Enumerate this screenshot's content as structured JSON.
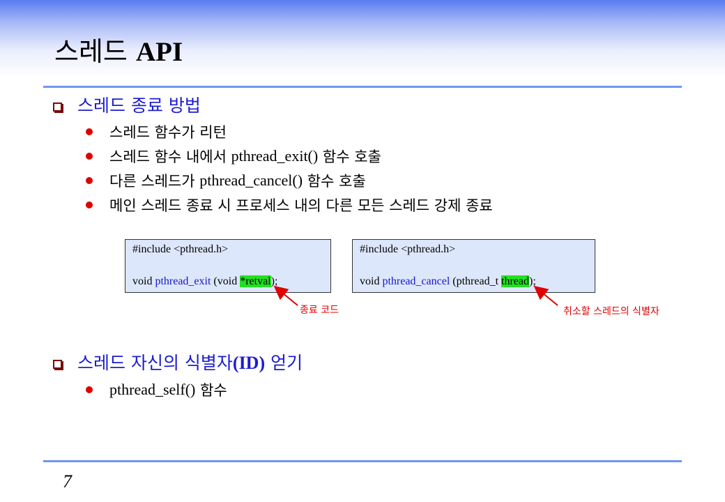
{
  "title": {
    "ko": "스레드",
    "api": "API"
  },
  "section1": {
    "heading": "스레드 종료 방법",
    "items": [
      {
        "ko_prefix": "스레드 함수가 리턴",
        "code": "",
        "ko_suffix": ""
      },
      {
        "ko_prefix": "스레드 함수 내에서 ",
        "code": "pthread_exit()",
        "ko_suffix": " 함수 호출"
      },
      {
        "ko_prefix": "다른 스레드가 ",
        "code": "pthread_cancel()",
        "ko_suffix": " 함수 호출"
      },
      {
        "ko_prefix": "메인 스레드 종료 시 프로세스 내의 다른 모든 스레드 강제 종료",
        "code": "",
        "ko_suffix": ""
      }
    ]
  },
  "code_exit": {
    "include": "#include <pthread.h>",
    "pre": "void ",
    "fn": "pthread_exit",
    "mid": " (void ",
    "arg": "*retval",
    "post": ");",
    "note": "종료 코드"
  },
  "code_cancel": {
    "include": "#include <pthread.h>",
    "pre": "void ",
    "fn": "pthread_cancel",
    "mid": " (pthread_t ",
    "arg": "thread",
    "post": ");",
    "note": "취소할 스레드의 식별자"
  },
  "section2": {
    "heading_ko": "스레드 자신의 식별자",
    "heading_id": "(ID)",
    "heading_tail": " 얻기",
    "items": [
      {
        "code": "pthread_self()",
        "ko_suffix": " 함수"
      }
    ]
  },
  "page_number": "7",
  "colors": {
    "heading": "#1b1bd0",
    "bullet": "#e00000",
    "rule": "#6f96f0",
    "code_bg": "#dde7fb",
    "highlight": "#22e022",
    "note": "#e00000"
  }
}
